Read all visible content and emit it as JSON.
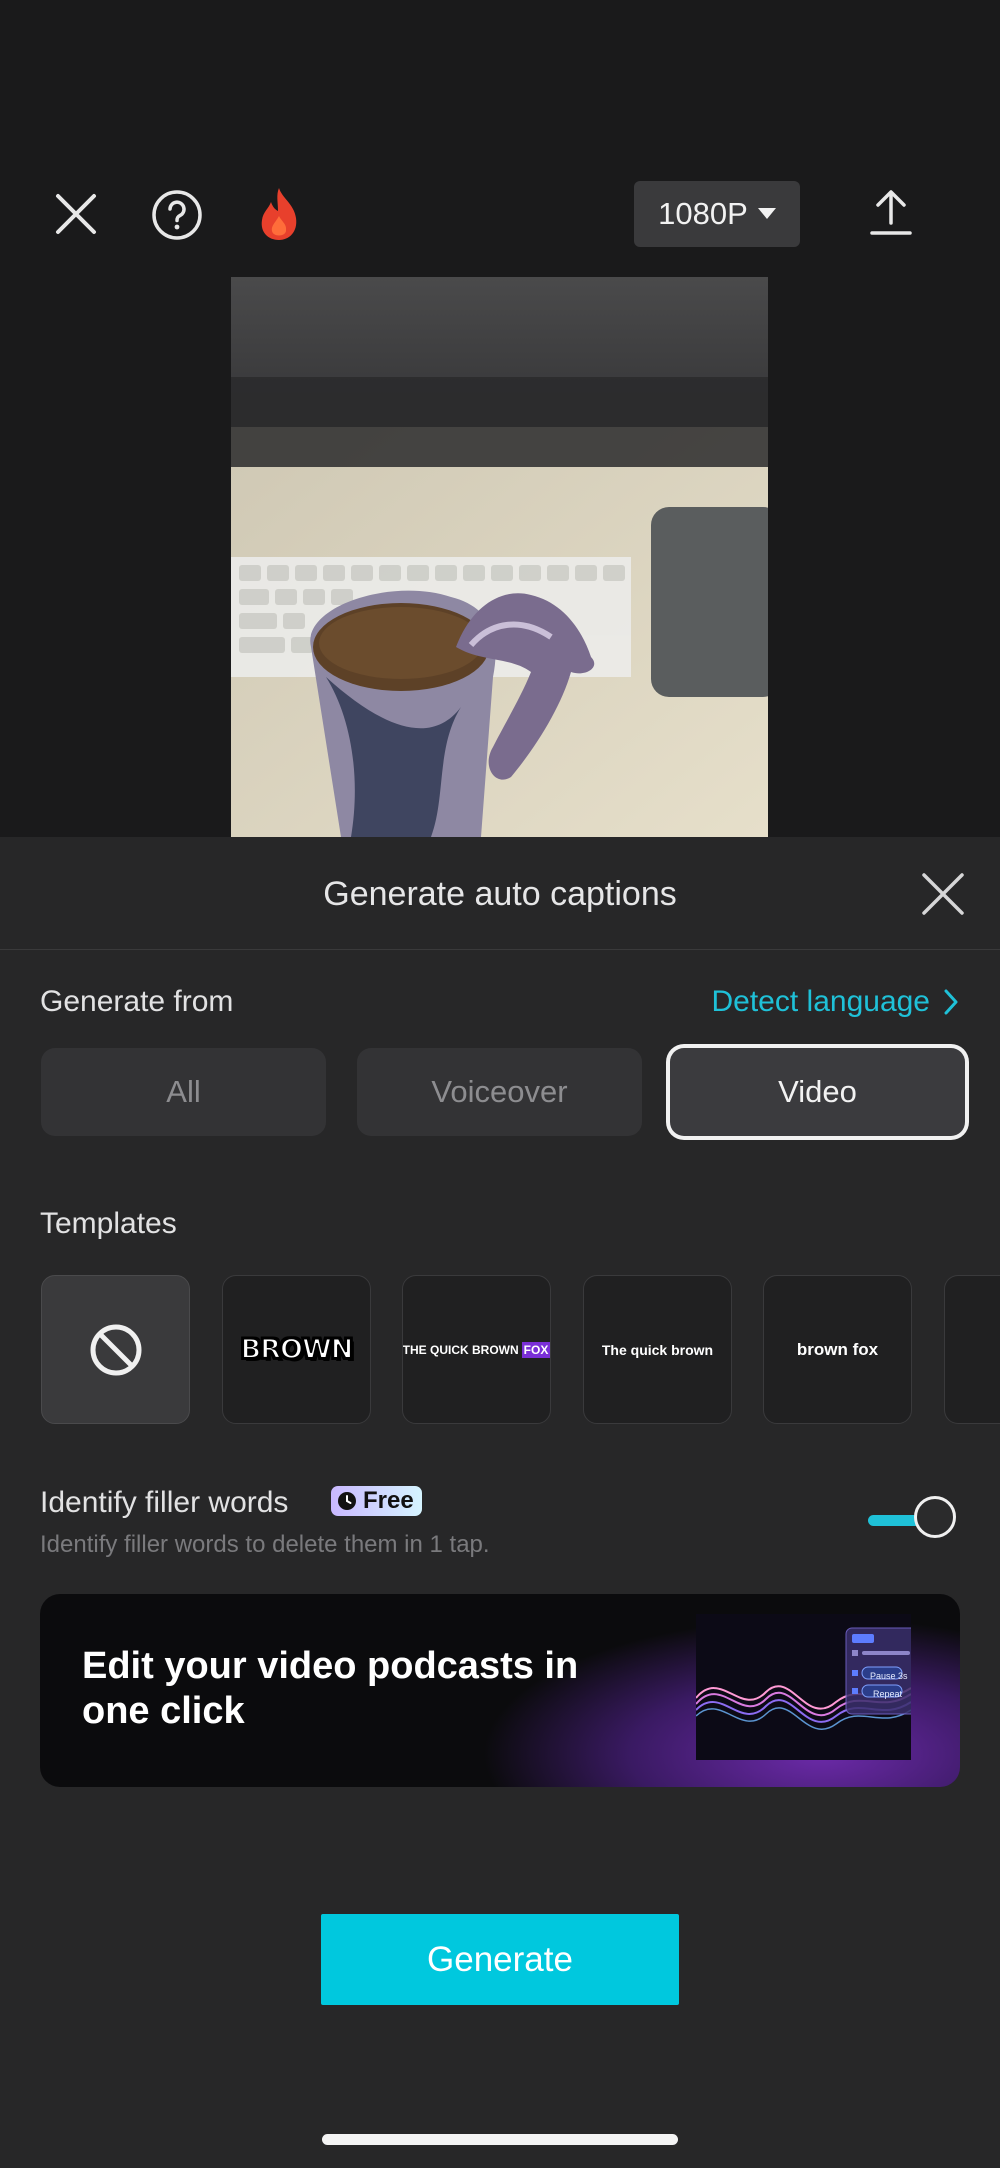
{
  "toolbar": {
    "close_icon": "close-icon",
    "help_icon": "help-icon",
    "fire_icon": "flame-icon",
    "resolution": "1080P",
    "export_icon": "upload-icon"
  },
  "sheet": {
    "title": "Generate auto captions",
    "generate_from_label": "Generate from",
    "detect_language": "Detect language",
    "sources": [
      "All",
      "Voiceover",
      "Video"
    ],
    "selected_source": "Video",
    "templates_label": "Templates",
    "templates": [
      "BROWN",
      "THE QUICK BROWN",
      "FOX",
      "The quick brown",
      "brown fox"
    ],
    "filler": {
      "title": "Identify filler words",
      "badge": "Free",
      "description": "Identify filler words to delete them in 1 tap.",
      "enabled": true
    },
    "banner": {
      "text": "Edit your video podcasts in one click",
      "panel_chips": [
        "Pause 3s",
        "Repeat"
      ]
    },
    "generate_button": "Generate"
  },
  "colors": {
    "accent": "#00c8de",
    "link": "#1fc1d8",
    "sheet_bg": "#272728",
    "page_bg": "#1a1a1b"
  }
}
